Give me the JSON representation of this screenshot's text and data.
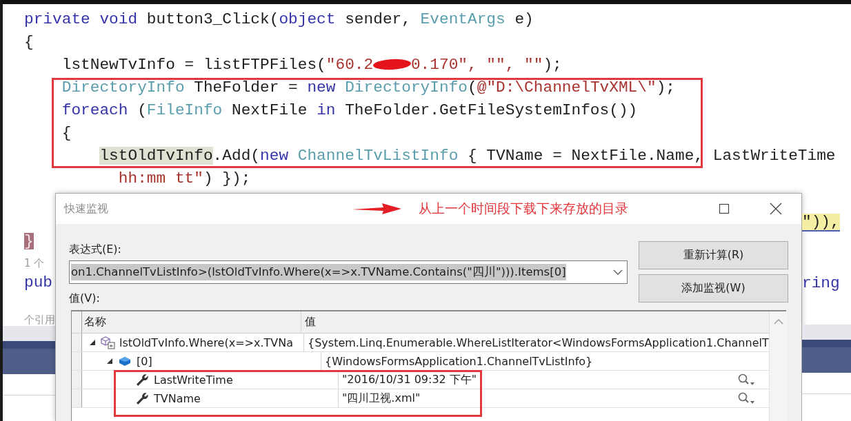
{
  "editor": {
    "lines": [
      {
        "kind": "statement",
        "segments": [
          {
            "kind": "code",
            "tokens": [
              {
                "kind": "keyword",
                "text": "private void "
              },
              {
                "kind": "plain",
                "text": "button3_Click("
              },
              {
                "kind": "keyword",
                "text": "object"
              },
              {
                "kind": "plain",
                "text": " sender, "
              },
              {
                "kind": "type",
                "text": "EventArgs"
              },
              {
                "kind": "plain",
                "text": " e)"
              }
            ]
          }
        ]
      },
      {
        "kind": "statement",
        "segments": [
          {
            "kind": "code",
            "tokens": [
              {
                "kind": "plain",
                "text": "{"
              }
            ]
          }
        ],
        "children": [
          {
            "kind": "statement",
            "segments": [
              {
                "kind": "code",
                "tokens": [
                  {
                    "kind": "plain",
                    "text": "lstNewTvInfo = listFTPFiles("
                  },
                  {
                    "kind": "string",
                    "text": "\"60.2"
                  }
                ]
              },
              {
                "kind": "redaction"
              },
              {
                "kind": "code",
                "tokens": [
                  {
                    "kind": "string",
                    "text": "0.170\", \"\", \"\""
                  },
                  {
                    "kind": "plain",
                    "text": ");"
                  }
                ]
              }
            ]
          },
          {
            "kind": "statement",
            "segments": [
              {
                "kind": "code",
                "tokens": [
                  {
                    "kind": "type",
                    "text": "DirectoryInfo"
                  },
                  {
                    "kind": "plain",
                    "text": " TheFolder = "
                  },
                  {
                    "kind": "keyword",
                    "text": "new "
                  },
                  {
                    "kind": "type",
                    "text": "DirectoryInfo"
                  },
                  {
                    "kind": "plain",
                    "text": "("
                  },
                  {
                    "kind": "string",
                    "text": "@\"D:\\ChannelTvXML\\\""
                  },
                  {
                    "kind": "plain",
                    "text": ");"
                  }
                ]
              }
            ]
          },
          {
            "kind": "statement",
            "segments": [
              {
                "kind": "code",
                "tokens": [
                  {
                    "kind": "keyword",
                    "text": "foreach"
                  },
                  {
                    "kind": "plain",
                    "text": " ("
                  },
                  {
                    "kind": "type",
                    "text": "FileInfo"
                  },
                  {
                    "kind": "plain",
                    "text": " NextFile "
                  },
                  {
                    "kind": "keyword",
                    "text": "in"
                  },
                  {
                    "kind": "plain",
                    "text": " TheFolder.GetFileSystemInfos())"
                  }
                ]
              }
            ]
          },
          {
            "kind": "statement",
            "segments": [
              {
                "kind": "code",
                "tokens": [
                  {
                    "kind": "plain",
                    "text": "{"
                  }
                ]
              }
            ],
            "children": [
              {
                "kind": "statement",
                "segments": [
                  {
                    "kind": "code",
                    "tokens": [
                      {
                        "kind": "reference",
                        "text": "lstOldTvInfo"
                      },
                      {
                        "kind": "plain",
                        "text": ".Add("
                      },
                      {
                        "kind": "keyword",
                        "text": "new "
                      },
                      {
                        "kind": "type",
                        "text": "ChannelTvListInfo"
                      },
                      {
                        "kind": "plain",
                        "text": " { TVName = NextFile.Name, LastWriteTime"
                      }
                    ]
                  }
                ],
                "children": [
                  {
                    "kind": "continuation",
                    "segments": [
                      {
                        "kind": "code",
                        "tokens": [
                          {
                            "kind": "string",
                            "text": "hh:mm tt\""
                          },
                          {
                            "kind": "plain",
                            "text": ") });"
                          }
                        ]
                      }
                    ]
                  }
                ]
              }
            ]
          }
        ]
      }
    ],
    "left_fragments": [
      {
        "kind": "brace-match",
        "text": "}"
      },
      {
        "kind": "codelens",
        "text": "1 个"
      },
      {
        "kind": "keyword",
        "text": "pub"
      },
      {
        "kind": "codelens",
        "text": "个引用"
      }
    ],
    "right_fragments": [
      {
        "kind": "highlight",
        "text": "\")),"
      },
      {
        "kind": "keyword",
        "text": "ring"
      }
    ]
  },
  "annotation": {
    "note": "从上一个时间段下载下来存放的目录"
  },
  "quick_watch": {
    "title": "快速监视",
    "expression_label": "表达式(E):",
    "expression": "on1.ChannelTvListInfo>(lstOldTvInfo.Where(x=>x.TVName.Contains(\"四川\"))).Items[0]",
    "expression_selected": true,
    "buttons": [
      "重新计算(R)",
      "添加监视(W)"
    ],
    "value_label": "值(V):",
    "columns": [
      "名称",
      "值"
    ],
    "rows": [
      {
        "kind": "enumerable",
        "name": "lstOldTvInfo.Where(x=>x.TVNa",
        "value": "{System.Linq.Enumerable.WhereListIterator<WindowsFormsApplication1.ChannelT",
        "expanded": true,
        "children": [
          {
            "kind": "object",
            "name": "[0]",
            "value": "{WindowsFormsApplication1.ChannelTvListInfo}",
            "expanded": true,
            "children": [
              {
                "kind": "property",
                "name": "LastWriteTime",
                "value": "\"2016/10/31 09:32 下午\""
              },
              {
                "kind": "property",
                "name": "TVName",
                "value": "\"四川卫视.xml\""
              }
            ]
          }
        ]
      }
    ]
  }
}
